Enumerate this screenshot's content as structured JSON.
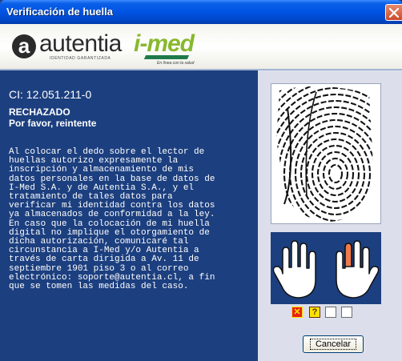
{
  "window": {
    "title": "Verificación de huella"
  },
  "banner": {
    "autentia_letter": "a",
    "autentia_name": "autentia",
    "autentia_tagline": "IDENTIDAD GARANTIZADA",
    "imed_name": "i-med",
    "imed_tagline": "En línea con la salud"
  },
  "identity": {
    "ci_label": "CI: 12.051.211-0",
    "status": "RECHAZADO",
    "instruction": "Por favor, reintente"
  },
  "legal": {
    "text": "Al colocar el dedo sobre el lector de\nhuellas autorizo expresamente la\ninscripción y almacenamiento de mis\ndatos personales en la base de datos de\nI-Med S.A. y de Autentia S.A., y el\ntratamiento de tales datos para\nverificar mi identidad contra los datos\nya almacenados de conformidad a la ley.\nEn caso que la colocación de mi huella\ndigital no implique el otorgamiento de\ndicha autorización, comunicaré tal\ncircunstancia a I-Med y/o Autentia a\ntravés de carta dirigida a Av. 11 de\nseptiembre 1901 piso 3 o al correo\nelectrónico: soporte@autentia.cl, a fin\nque se tomen las medidas del caso."
  },
  "fingers": {
    "highlighted": "right index finger",
    "attempts": [
      {
        "state": "rejected",
        "symbol": "✕"
      },
      {
        "state": "unknown",
        "symbol": "?"
      },
      {
        "state": "pending",
        "symbol": ""
      },
      {
        "state": "pending",
        "symbol": ""
      }
    ]
  },
  "colors": {
    "panel_blue": "#1c3f7f",
    "highlight_finger": "#f07a4a",
    "rejected": "#e8201a",
    "unknown": "#ffe400"
  },
  "actions": {
    "cancel_label": "Cancelar"
  }
}
